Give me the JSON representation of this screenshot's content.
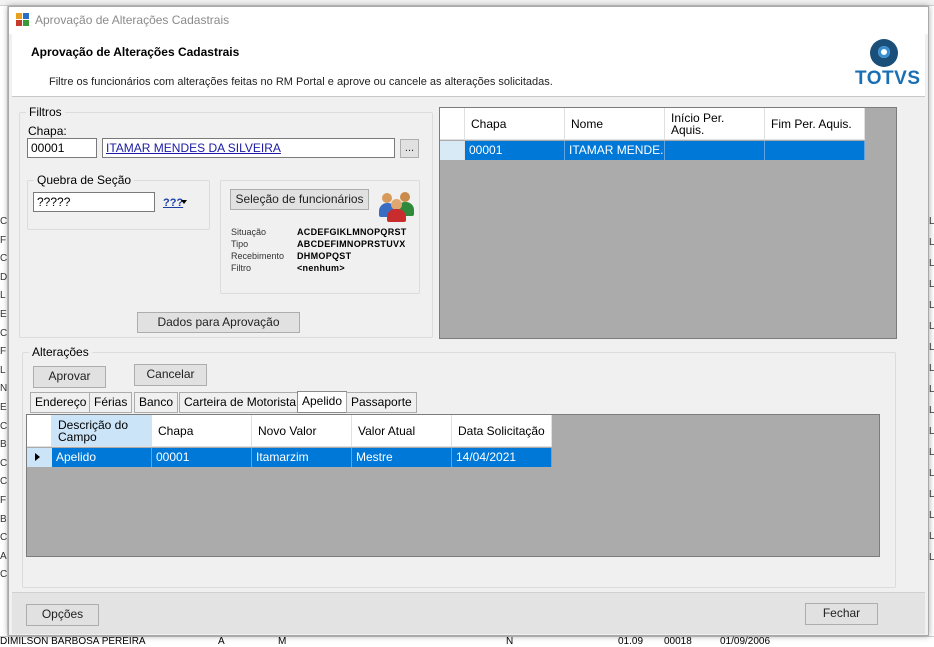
{
  "window": {
    "title": "Aprovação de Alterações Cadastrais"
  },
  "header": {
    "title": "Aprovação de Alterações Cadastrais",
    "subtitle": "Filtre os funcionários com alterações feitas no RM Portal e aprove ou cancele as alterações solicitadas.",
    "logo_text": "TOTVS"
  },
  "filters": {
    "legend": "Filtros",
    "chapa_label": "Chapa:",
    "chapa_value": "00001",
    "name_value": "ITAMAR MENDES DA SILVEIRA",
    "ellipsis_label": "...",
    "quebra_legend": "Quebra de Seção",
    "quebra_value": "?????",
    "quebra_menu": "???",
    "selection_button": "Seleção de funcionários",
    "info": [
      {
        "key": "Situação",
        "value": "ACDEFGIKLMNOPQRST"
      },
      {
        "key": "Tipo",
        "value": "ABCDEFIMNOPRSTUVX"
      },
      {
        "key": "Recebimento",
        "value": "DHMOPQST"
      },
      {
        "key": "Filtro",
        "value": "<nenhum>"
      }
    ],
    "dados_button": "Dados para Aprovação"
  },
  "employees_grid": {
    "columns": [
      "Chapa",
      "Nome",
      "Início Per. Aquis.",
      "Fim Per. Aquis."
    ],
    "rows": [
      [
        "00001",
        "ITAMAR MENDE...",
        "",
        ""
      ]
    ]
  },
  "changes": {
    "legend": "Alterações",
    "approve_button": "Aprovar",
    "cancel_button": "Cancelar",
    "tabs": [
      "Endereço",
      "Férias",
      "Banco",
      "Carteira de Motorista",
      "Apelido",
      "Passaporte"
    ],
    "active_tab": "Apelido",
    "columns": [
      "Descrição do Campo",
      "Chapa",
      "Novo Valor",
      "Valor Atual",
      "Data Solicitação"
    ],
    "rows": [
      [
        "Apelido",
        "00001",
        "Itamarzim",
        "Mestre",
        "14/04/2021"
      ]
    ]
  },
  "footer": {
    "options_button": "Opções",
    "close_button": "Fechar"
  },
  "background_fragments": {
    "bottom_name": "DIMILSON BARBOSA PEREIRA",
    "bottom_a": "A",
    "bottom_m": "M",
    "bottom_n": "N",
    "bottom_n1": "01.09",
    "bottom_n2": "00018",
    "bottom_date": "01/09/2006",
    "left_letters": [
      "C",
      "F",
      "C",
      "D",
      "L",
      "E",
      "C",
      "F",
      "L",
      "N",
      "E",
      "C",
      "B",
      "C",
      "C",
      "F",
      "B",
      "C",
      "A",
      "C"
    ],
    "right_letters": [
      "L",
      "L",
      "L",
      "L",
      "L",
      "L",
      "L",
      "L",
      "L",
      "L",
      "L",
      "L",
      "L",
      "L",
      "L",
      "L",
      "L"
    ]
  },
  "colors": {
    "selection": "#0078d7",
    "grid_bg": "#ababab",
    "logo_blue": "#1a6fb3"
  }
}
